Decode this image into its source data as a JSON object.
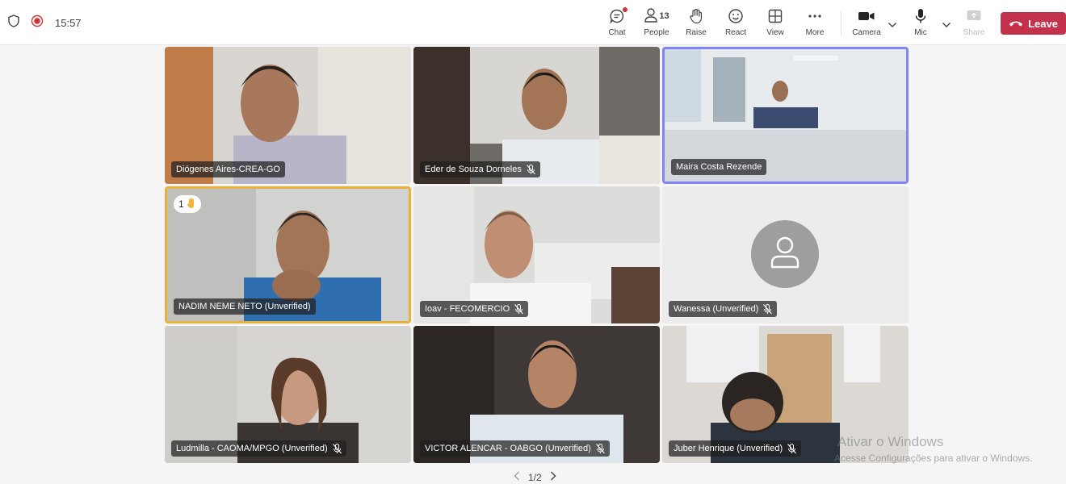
{
  "meeting": {
    "elapsed": "15:57"
  },
  "toolbar": {
    "chat": "Chat",
    "people": "People",
    "people_count": "13",
    "raise": "Raise",
    "react": "React",
    "view": "View",
    "more": "More",
    "camera": "Camera",
    "mic": "Mic",
    "share": "Share",
    "leave": "Leave"
  },
  "participants": [
    {
      "name": "Diógenes Aires-CREA-GO",
      "muted": false
    },
    {
      "name": "Eder de Souza Dorneles",
      "muted": true
    },
    {
      "name": "Maira Costa Rezende",
      "muted": false,
      "speaking": true
    },
    {
      "name": "NADIM NEME NETO (Unverified)",
      "muted": false,
      "hand_raised": true,
      "hand_order": "1"
    },
    {
      "name": "Ioav - FECOMERCIO",
      "muted": true
    },
    {
      "name": "Wanessa (Unverified)",
      "muted": true,
      "camera_off": true
    },
    {
      "name": "Ludmilla - CAOMA/MPGO (Unverified)",
      "muted": true
    },
    {
      "name": "VICTOR ALENCAR - OABGO (Unverified)",
      "muted": true
    },
    {
      "name": "Juber Henrique (Unverified)",
      "muted": true
    }
  ],
  "pagination": {
    "label": "1/2"
  },
  "watermark": {
    "line1": "Ativar o Windows",
    "line2": "Acesse Configurações para ativar o Windows."
  },
  "colors": {
    "leave": "#c4314b",
    "active_speaker": "#7f85f5",
    "hand_raised": "#e8b23a"
  }
}
